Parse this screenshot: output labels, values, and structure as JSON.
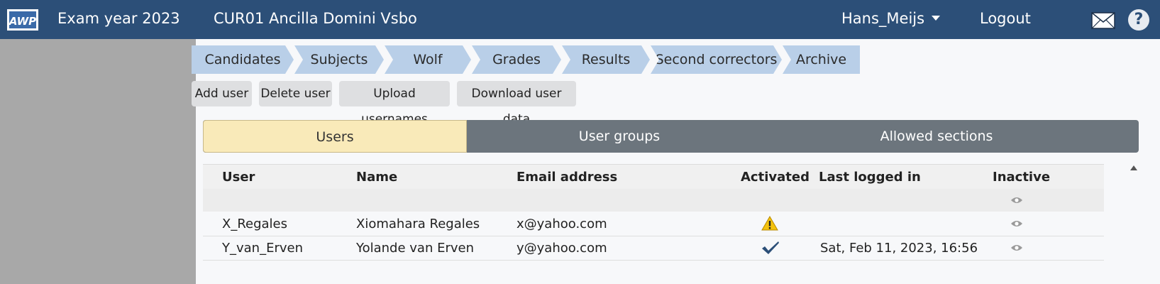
{
  "header": {
    "logo_text": "AWP",
    "exam_year": "Exam year 2023",
    "school": "CUR01 Ancilla Domini Vsbo",
    "user": "Hans_Meijs",
    "logout": "Logout",
    "help": "?"
  },
  "steps": [
    "Candidates",
    "Subjects",
    "Wolf",
    "Grades",
    "Results",
    "Second correctors",
    "Archive"
  ],
  "toolbar": {
    "add_user": "Add user",
    "delete_user": "Delete user",
    "upload_usernames": "Upload usernames",
    "download_user_data": "Download user data"
  },
  "tabs": {
    "users": "Users",
    "user_groups": "User groups",
    "allowed_sections": "Allowed sections"
  },
  "table": {
    "headers": {
      "user": "User",
      "name": "Name",
      "email": "Email address",
      "activated": "Activated",
      "last_logged_in": "Last logged in",
      "inactive": "Inactive"
    },
    "rows": [
      {
        "user": "X_Regales",
        "name": "Xiomahara Regales",
        "email": "x@yahoo.com",
        "activated": "warning-icon",
        "last_logged_in": "",
        "inactive": "eye-icon"
      },
      {
        "user": "Y_van_Erven",
        "name": "Yolande van Erven",
        "email": "y@yahoo.com",
        "activated": "checkmark-icon",
        "last_logged_in": "Sat, Feb 11, 2023, 16:56",
        "inactive": "eye-icon"
      }
    ]
  },
  "colors": {
    "topbar": "#2c4f78",
    "step": "#b9cfe8",
    "tab_active": "#f9eab9",
    "tab_inactive": "#6c757d",
    "sidebar": "#a8a8a8"
  }
}
